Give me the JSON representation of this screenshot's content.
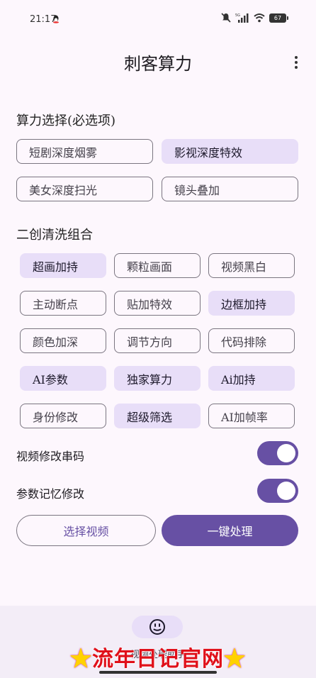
{
  "status": {
    "time": "21:17",
    "battery": "67",
    "network": "5G"
  },
  "app": {
    "title": "刺客算力"
  },
  "section1": {
    "title": "算力选择(必选项)",
    "chips": [
      {
        "label": "短剧深度烟雾",
        "selected": false
      },
      {
        "label": "影视深度特效",
        "selected": true
      },
      {
        "label": "美女深度扫光",
        "selected": false
      },
      {
        "label": "镜头叠加",
        "selected": false
      }
    ]
  },
  "section2": {
    "title": "二创清洗组合",
    "chips": [
      {
        "label": "超画加持",
        "selected": true
      },
      {
        "label": "颗粒画面",
        "selected": false
      },
      {
        "label": "视频黑白",
        "selected": false
      },
      {
        "label": "主动断点",
        "selected": false
      },
      {
        "label": "贴加特效",
        "selected": false
      },
      {
        "label": "边框加持",
        "selected": true
      },
      {
        "label": "颜色加深",
        "selected": false
      },
      {
        "label": "调节方向",
        "selected": false
      },
      {
        "label": "代码排除",
        "selected": false
      },
      {
        "label": "AI参数",
        "selected": true
      },
      {
        "label": "独家算力",
        "selected": true
      },
      {
        "label": "Ai加持",
        "selected": true
      },
      {
        "label": "身份修改",
        "selected": false
      },
      {
        "label": "超级筛选",
        "selected": true
      },
      {
        "label": "AI加帧率",
        "selected": false
      }
    ]
  },
  "switches": [
    {
      "label": "视频修改串码",
      "on": true
    },
    {
      "label": "参数记忆修改",
      "on": true
    }
  ],
  "buttons": {
    "select_video": "选择视频",
    "process": "一键处理"
  },
  "bottom_nav": {
    "label": "视频处理助手"
  },
  "watermark": {
    "text": "流年日记官网"
  },
  "colors": {
    "primary": "#6750a4",
    "chip_selected": "#e8def8",
    "background": "#fdf7fd"
  }
}
